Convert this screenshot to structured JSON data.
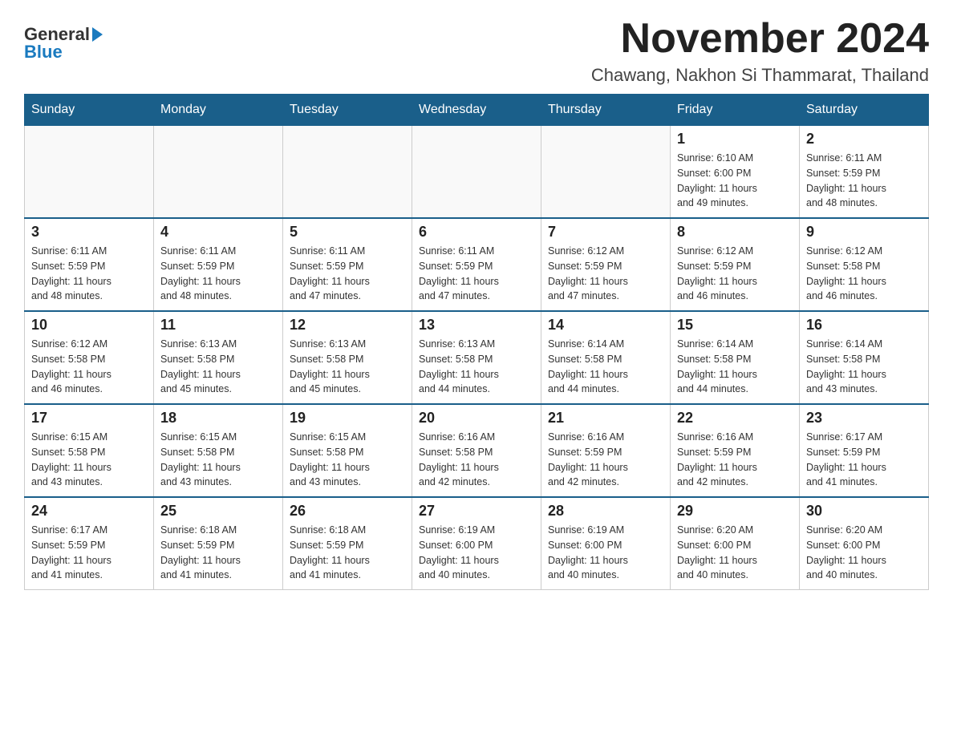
{
  "logo": {
    "general": "General",
    "blue": "Blue",
    "arrow": "▶"
  },
  "title": "November 2024",
  "location": "Chawang, Nakhon Si Thammarat, Thailand",
  "days_of_week": [
    "Sunday",
    "Monday",
    "Tuesday",
    "Wednesday",
    "Thursday",
    "Friday",
    "Saturday"
  ],
  "weeks": [
    [
      {
        "day": "",
        "info": ""
      },
      {
        "day": "",
        "info": ""
      },
      {
        "day": "",
        "info": ""
      },
      {
        "day": "",
        "info": ""
      },
      {
        "day": "",
        "info": ""
      },
      {
        "day": "1",
        "info": "Sunrise: 6:10 AM\nSunset: 6:00 PM\nDaylight: 11 hours\nand 49 minutes."
      },
      {
        "day": "2",
        "info": "Sunrise: 6:11 AM\nSunset: 5:59 PM\nDaylight: 11 hours\nand 48 minutes."
      }
    ],
    [
      {
        "day": "3",
        "info": "Sunrise: 6:11 AM\nSunset: 5:59 PM\nDaylight: 11 hours\nand 48 minutes."
      },
      {
        "day": "4",
        "info": "Sunrise: 6:11 AM\nSunset: 5:59 PM\nDaylight: 11 hours\nand 48 minutes."
      },
      {
        "day": "5",
        "info": "Sunrise: 6:11 AM\nSunset: 5:59 PM\nDaylight: 11 hours\nand 47 minutes."
      },
      {
        "day": "6",
        "info": "Sunrise: 6:11 AM\nSunset: 5:59 PM\nDaylight: 11 hours\nand 47 minutes."
      },
      {
        "day": "7",
        "info": "Sunrise: 6:12 AM\nSunset: 5:59 PM\nDaylight: 11 hours\nand 47 minutes."
      },
      {
        "day": "8",
        "info": "Sunrise: 6:12 AM\nSunset: 5:59 PM\nDaylight: 11 hours\nand 46 minutes."
      },
      {
        "day": "9",
        "info": "Sunrise: 6:12 AM\nSunset: 5:58 PM\nDaylight: 11 hours\nand 46 minutes."
      }
    ],
    [
      {
        "day": "10",
        "info": "Sunrise: 6:12 AM\nSunset: 5:58 PM\nDaylight: 11 hours\nand 46 minutes."
      },
      {
        "day": "11",
        "info": "Sunrise: 6:13 AM\nSunset: 5:58 PM\nDaylight: 11 hours\nand 45 minutes."
      },
      {
        "day": "12",
        "info": "Sunrise: 6:13 AM\nSunset: 5:58 PM\nDaylight: 11 hours\nand 45 minutes."
      },
      {
        "day": "13",
        "info": "Sunrise: 6:13 AM\nSunset: 5:58 PM\nDaylight: 11 hours\nand 44 minutes."
      },
      {
        "day": "14",
        "info": "Sunrise: 6:14 AM\nSunset: 5:58 PM\nDaylight: 11 hours\nand 44 minutes."
      },
      {
        "day": "15",
        "info": "Sunrise: 6:14 AM\nSunset: 5:58 PM\nDaylight: 11 hours\nand 44 minutes."
      },
      {
        "day": "16",
        "info": "Sunrise: 6:14 AM\nSunset: 5:58 PM\nDaylight: 11 hours\nand 43 minutes."
      }
    ],
    [
      {
        "day": "17",
        "info": "Sunrise: 6:15 AM\nSunset: 5:58 PM\nDaylight: 11 hours\nand 43 minutes."
      },
      {
        "day": "18",
        "info": "Sunrise: 6:15 AM\nSunset: 5:58 PM\nDaylight: 11 hours\nand 43 minutes."
      },
      {
        "day": "19",
        "info": "Sunrise: 6:15 AM\nSunset: 5:58 PM\nDaylight: 11 hours\nand 43 minutes."
      },
      {
        "day": "20",
        "info": "Sunrise: 6:16 AM\nSunset: 5:58 PM\nDaylight: 11 hours\nand 42 minutes."
      },
      {
        "day": "21",
        "info": "Sunrise: 6:16 AM\nSunset: 5:59 PM\nDaylight: 11 hours\nand 42 minutes."
      },
      {
        "day": "22",
        "info": "Sunrise: 6:16 AM\nSunset: 5:59 PM\nDaylight: 11 hours\nand 42 minutes."
      },
      {
        "day": "23",
        "info": "Sunrise: 6:17 AM\nSunset: 5:59 PM\nDaylight: 11 hours\nand 41 minutes."
      }
    ],
    [
      {
        "day": "24",
        "info": "Sunrise: 6:17 AM\nSunset: 5:59 PM\nDaylight: 11 hours\nand 41 minutes."
      },
      {
        "day": "25",
        "info": "Sunrise: 6:18 AM\nSunset: 5:59 PM\nDaylight: 11 hours\nand 41 minutes."
      },
      {
        "day": "26",
        "info": "Sunrise: 6:18 AM\nSunset: 5:59 PM\nDaylight: 11 hours\nand 41 minutes."
      },
      {
        "day": "27",
        "info": "Sunrise: 6:19 AM\nSunset: 6:00 PM\nDaylight: 11 hours\nand 40 minutes."
      },
      {
        "day": "28",
        "info": "Sunrise: 6:19 AM\nSunset: 6:00 PM\nDaylight: 11 hours\nand 40 minutes."
      },
      {
        "day": "29",
        "info": "Sunrise: 6:20 AM\nSunset: 6:00 PM\nDaylight: 11 hours\nand 40 minutes."
      },
      {
        "day": "30",
        "info": "Sunrise: 6:20 AM\nSunset: 6:00 PM\nDaylight: 11 hours\nand 40 minutes."
      }
    ]
  ]
}
